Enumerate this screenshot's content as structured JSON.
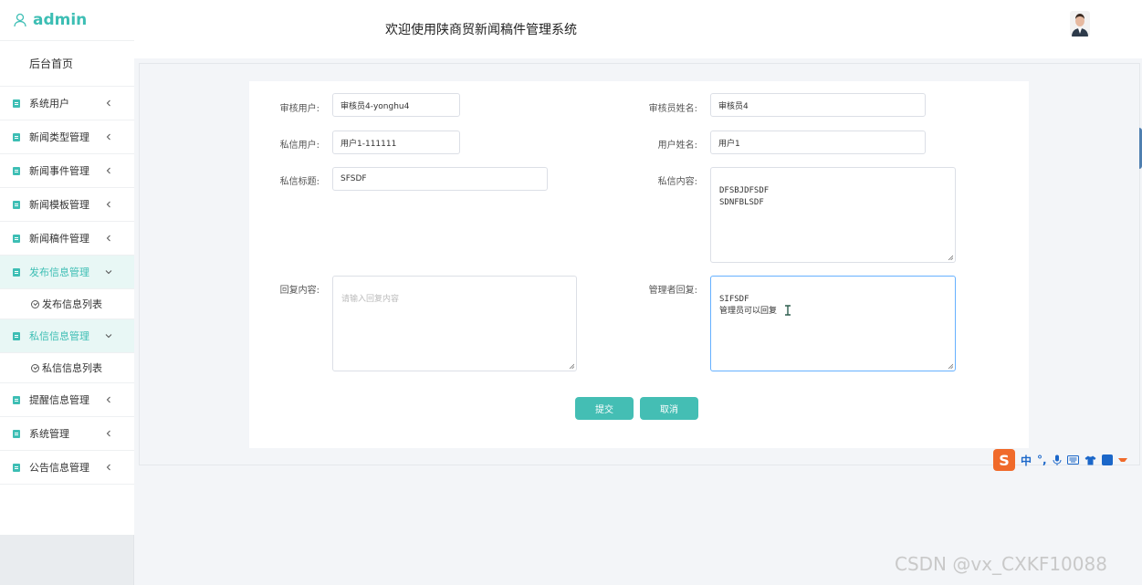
{
  "brand": {
    "name": "admin"
  },
  "header": {
    "title": "欢迎使用陕商贸新闻稿件管理系统"
  },
  "sidebar": {
    "home": "后台首页",
    "items": [
      {
        "label": "系统用户",
        "expanded": false
      },
      {
        "label": "新闻类型管理",
        "expanded": false
      },
      {
        "label": "新闻事件管理",
        "expanded": false
      },
      {
        "label": "新闻模板管理",
        "expanded": false
      },
      {
        "label": "新闻稿件管理",
        "expanded": false
      },
      {
        "label": "发布信息管理",
        "expanded": true,
        "sub": "发布信息列表"
      },
      {
        "label": "私信信息管理",
        "expanded": true,
        "sub": "私信信息列表"
      },
      {
        "label": "提醒信息管理",
        "expanded": false
      },
      {
        "label": "系统管理",
        "expanded": false
      },
      {
        "label": "公告信息管理",
        "expanded": false
      }
    ]
  },
  "form": {
    "reviewer_user": {
      "label": "审核用户:",
      "value": "审核员4-yonghu4"
    },
    "reviewer_name": {
      "label": "审核员姓名:",
      "value": "审核员4"
    },
    "dm_user": {
      "label": "私信用户:",
      "value": "用户1-111111"
    },
    "user_name": {
      "label": "用户姓名:",
      "value": "用户1"
    },
    "dm_title": {
      "label": "私信标题:",
      "value": "SFSDF"
    },
    "dm_content": {
      "label": "私信内容:",
      "value": "DFSBJDFSDF\nSDNFBLSDF"
    },
    "reply_content": {
      "label": "回复内容:",
      "placeholder": "请输入回复内容"
    },
    "admin_reply": {
      "label": "管理者回复:",
      "value": "SIFSDF\n管理员可以回复"
    }
  },
  "buttons": {
    "submit": "提交",
    "cancel": "取消"
  },
  "ime": {
    "label": "中"
  },
  "watermark": "CSDN @vx_CXKF10088",
  "colors": {
    "accent": "#44beb4",
    "focus": "#66b1ff"
  }
}
